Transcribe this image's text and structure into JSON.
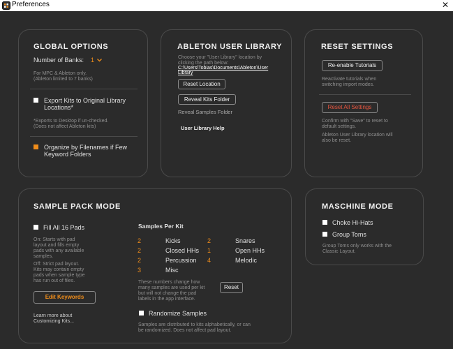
{
  "window": {
    "title": "Preferences",
    "close_glyph": "✕"
  },
  "global_options": {
    "title": "GLOBAL OPTIONS",
    "banks_label": "Number of Banks:",
    "banks_value": "1",
    "banks_note_1": "For MPC & Ableton only.",
    "banks_note_2": "(Ableton limited to 7 banks)",
    "export_label_1": "Export Kits to Original Library",
    "export_label_2": "Locations*",
    "export_checked": false,
    "export_note_1": "*Exports to Desktop if un-checked.",
    "export_note_2": "(Does not affect Ableton kits)",
    "organize_label_1": "Organize by Filenames if Few",
    "organize_label_2": "Keyword Folders",
    "organize_checked": true
  },
  "ableton_library": {
    "title": "ABLETON USER LIBRARY",
    "desc_1": "Choose your \"User Library\" location by",
    "desc_2": "clicking the path below:",
    "path_1": "C:\\Users\\Tobias\\Documents\\Ableton\\User",
    "path_2": "Library",
    "reset_location": "Reset Location",
    "reveal_kits": "Reveal Kits Folder",
    "reveal_samples": "Reveal Samples Folder",
    "help": "User Library Help"
  },
  "reset_settings": {
    "title": "RESET SETTINGS",
    "reenable": "Re-enable Tutorials",
    "reenable_note_1": "Reactivate tutorials when",
    "reenable_note_2": "switching import modes.",
    "reset_all": "Reset All Settings",
    "reset_note_1": "Confirm with \"Save\" to reset to",
    "reset_note_2": "default settings.",
    "ableton_note_1": "Ableton User Library location will",
    "ableton_note_2": "also be reset."
  },
  "sample_pack": {
    "title": "SAMPLE PACK MODE",
    "fill_label": "Fill All 16 Pads",
    "fill_checked": false,
    "on_note": [
      "On: Starts with pad",
      "layout and fills empty",
      "pads with any available",
      "samples."
    ],
    "off_note": [
      "Off: Strict pad layout.",
      "Kits may contain empty",
      "pads when sample type",
      "has run out of files."
    ],
    "edit_keywords": "Edit Keywords",
    "learn_1": "Learn more about",
    "learn_2": "Customizing Kits...",
    "samples_per_kit": "Samples Per Kit",
    "left": [
      {
        "value": "2",
        "label": "Kicks"
      },
      {
        "value": "2",
        "label": "Closed HHs"
      },
      {
        "value": "2",
        "label": "Percussion"
      },
      {
        "value": "3",
        "label": "Misc"
      }
    ],
    "right": [
      {
        "value": "2",
        "label": "Snares"
      },
      {
        "value": "1",
        "label": "Open HHs"
      },
      {
        "value": "4",
        "label": "Melodic"
      }
    ],
    "numbers_note": [
      "These numbers change how",
      "many samples are used per kit",
      "but will not change the pad",
      "labels in the app interface."
    ],
    "reset": "Reset",
    "randomize_label": "Randomize Samples",
    "randomize_checked": false,
    "distribution_note_1": "Samples are distributed to kits alphabetically, or can",
    "distribution_note_2": "be randomized. Does not affect pad layout."
  },
  "maschine": {
    "title": "MASCHINE MODE",
    "choke_label": "Choke Hi-Hats",
    "choke_checked": false,
    "group_label": "Group Toms",
    "group_checked": false,
    "note_1": "Group Toms only works with the",
    "note_2": "Classic Layout."
  },
  "colors": {
    "accent": "#f08d1a",
    "danger": "#e8553f",
    "background": "#2b2b2b",
    "border": "#4a4a4a"
  }
}
